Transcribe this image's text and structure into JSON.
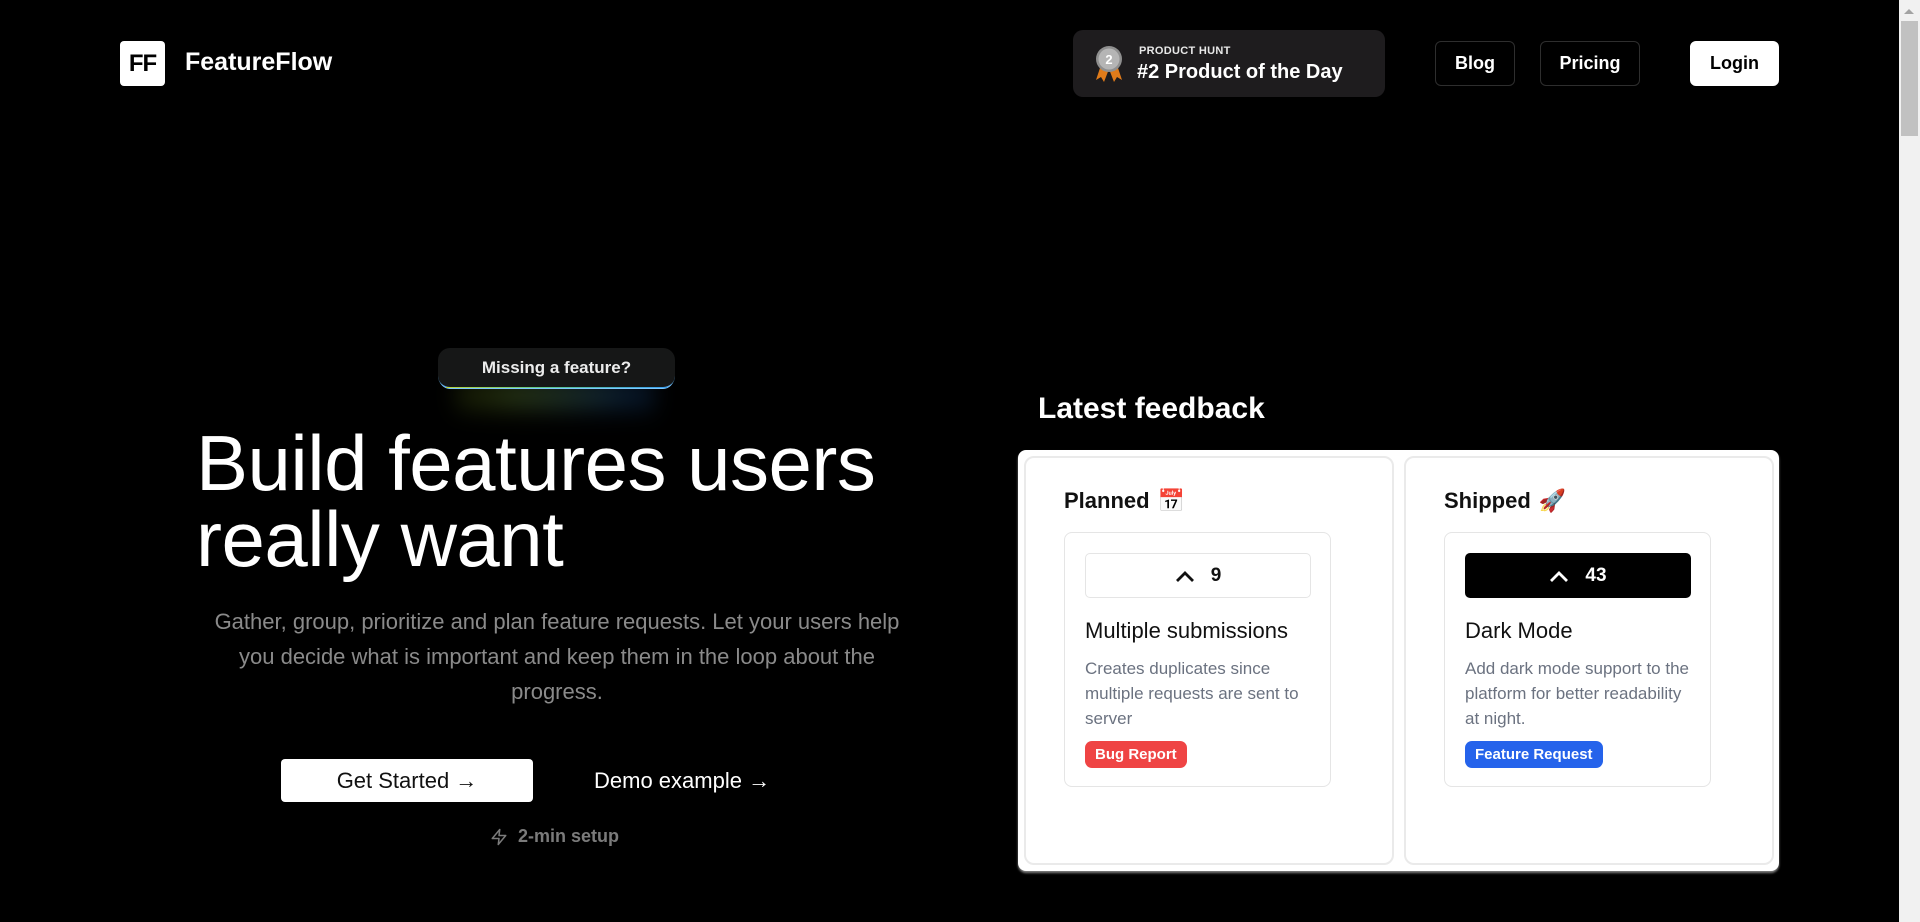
{
  "brand": {
    "logo_text": "FF",
    "name": "FeatureFlow"
  },
  "product_hunt": {
    "medal_number": "2",
    "label": "PRODUCT HUNT",
    "title": "#2 Product of the Day"
  },
  "nav": {
    "blog": "Blog",
    "pricing": "Pricing",
    "login": "Login"
  },
  "hero": {
    "pill": "Missing a feature?",
    "headline": "Build features users really want",
    "subtext": "Gather, group, prioritize and plan feature requests. Let your users help you decide what is important and keep them in the loop about the progress.",
    "cta_primary": "Get Started →",
    "cta_secondary": "Demo example →",
    "setup_note": "2-min setup"
  },
  "feedback": {
    "title": "Latest feedback",
    "columns": [
      {
        "title": "Planned",
        "emoji": "📅",
        "cards": [
          {
            "votes": "9",
            "voted": false,
            "title": "Multiple submissions",
            "description": "Creates duplicates since multiple requests are sent to server",
            "tag": "Bug Report",
            "tag_color": "#ef4444"
          }
        ]
      },
      {
        "title": "Shipped",
        "emoji": "🚀",
        "cards": [
          {
            "votes": "43",
            "voted": true,
            "title": "Dark Mode",
            "description": "Add dark mode support to the platform for better readability at night.",
            "tag": "Feature Request",
            "tag_color": "#2563eb"
          }
        ]
      }
    ]
  },
  "colors": {
    "background": "#000000",
    "bug_tag": "#ef4444",
    "feature_tag": "#2563eb",
    "medal_silver": "#a8a8a8",
    "medal_ribbon": "#e07b1a"
  }
}
